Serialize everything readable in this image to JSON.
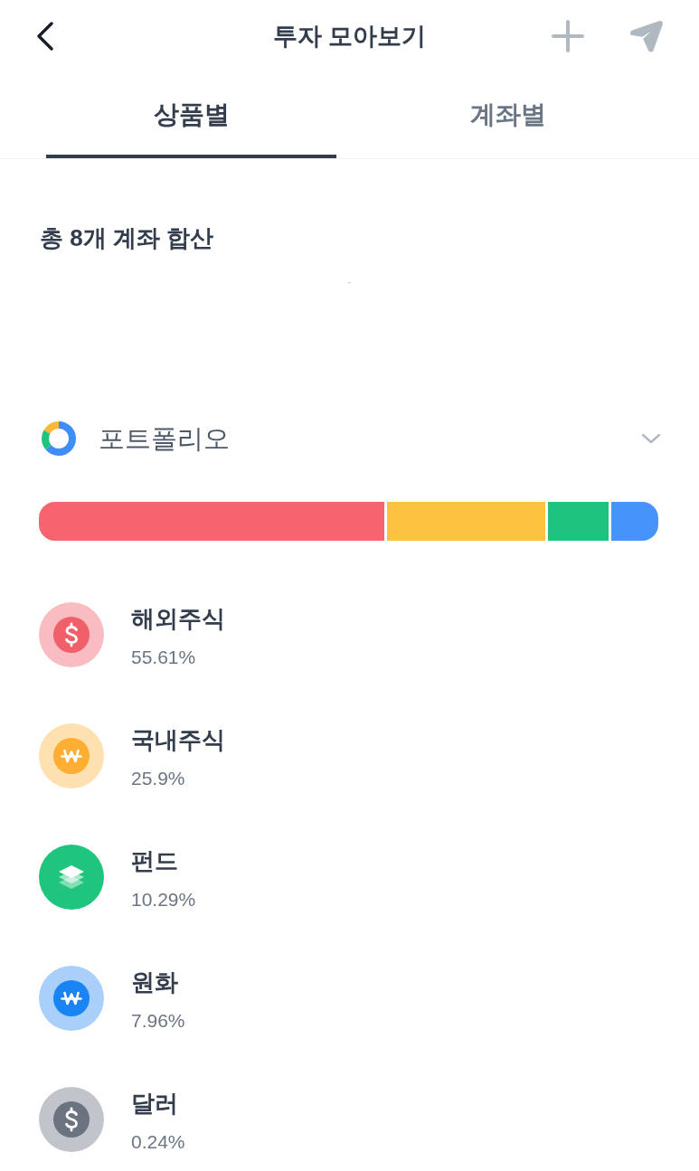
{
  "header": {
    "title": "투자 모아보기"
  },
  "tabs": [
    {
      "label": "상품별",
      "selected": true
    },
    {
      "label": "계좌별",
      "selected": false
    }
  ],
  "summary": {
    "title": "총 8개 계좌 합산",
    "amount": "-"
  },
  "portfolio": {
    "label": "포트폴리오"
  },
  "assets": [
    {
      "kind": "dollar",
      "name": "해외주식",
      "share": "55.61%",
      "color": "#f0606b"
    },
    {
      "kind": "won",
      "name": "국내주식",
      "share": "25.9%",
      "color": "#fdae33"
    },
    {
      "kind": "layers",
      "name": "펀드",
      "share": "10.29%",
      "color": "#1fc47d"
    },
    {
      "kind": "won",
      "name": "원화",
      "share": "7.96%",
      "color": "#1b84f5"
    },
    {
      "kind": "dollar",
      "name": "달러",
      "share": "0.24%",
      "color": "#6b7380"
    }
  ]
}
